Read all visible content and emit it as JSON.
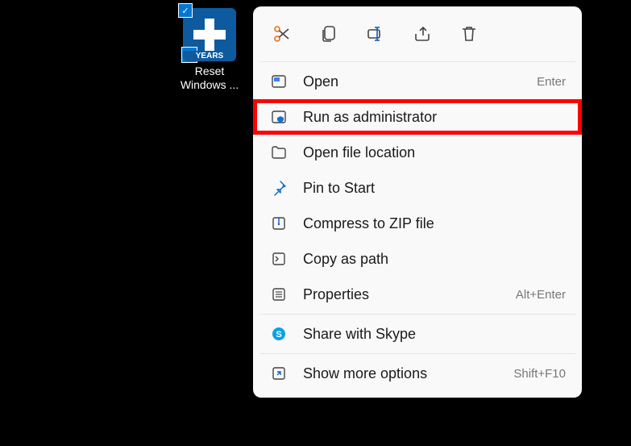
{
  "desktop": {
    "icon_label": "Reset\nWindows ...",
    "years_band": "YEARS"
  },
  "menu": {
    "items": [
      {
        "label": "Open",
        "shortcut": "Enter"
      },
      {
        "label": "Run as administrator",
        "shortcut": ""
      },
      {
        "label": "Open file location",
        "shortcut": ""
      },
      {
        "label": "Pin to Start",
        "shortcut": ""
      },
      {
        "label": "Compress to ZIP file",
        "shortcut": ""
      },
      {
        "label": "Copy as path",
        "shortcut": ""
      },
      {
        "label": "Properties",
        "shortcut": "Alt+Enter"
      },
      {
        "label": "Share with Skype",
        "shortcut": ""
      },
      {
        "label": "Show more options",
        "shortcut": "Shift+F10"
      }
    ]
  }
}
